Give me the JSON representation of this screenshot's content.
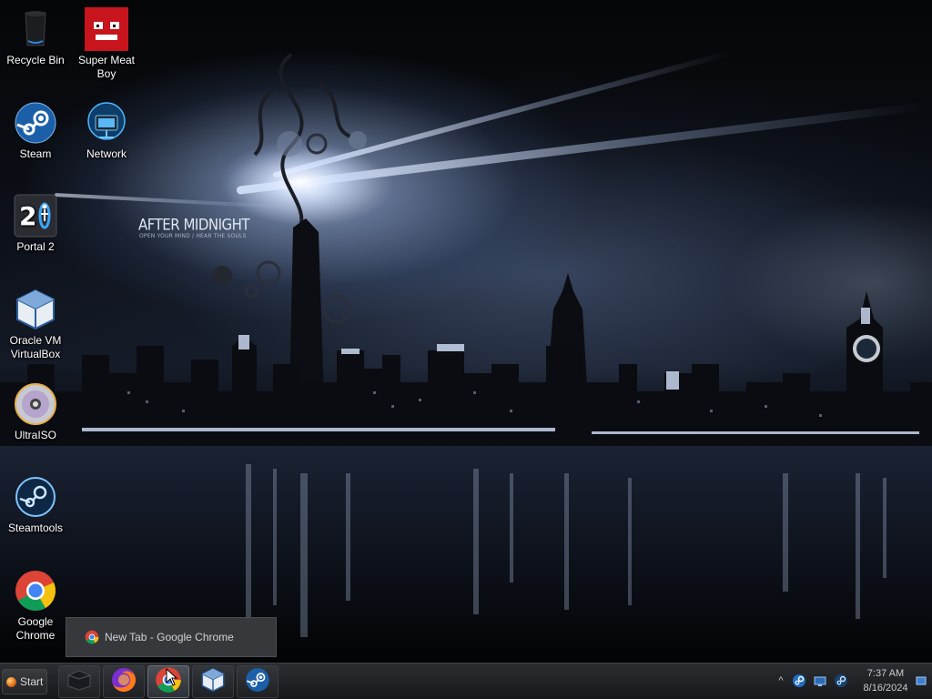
{
  "wallpaper": {
    "title": "AFTER MIDNIGHT",
    "subtitle": "OPEN YOUR MIND / HEAR THE SOULS"
  },
  "desktop_icons": [
    {
      "label": "Recycle Bin",
      "icon": "recycle-bin-icon"
    },
    {
      "label": "Super Meat Boy",
      "icon": "super-meat-boy-icon"
    },
    {
      "label": "Steam",
      "icon": "steam-icon"
    },
    {
      "label": "Network",
      "icon": "network-icon"
    },
    {
      "label": "Portal 2",
      "icon": "portal-2-icon"
    },
    {
      "label": "Oracle VM VirtualBox",
      "icon": "virtualbox-icon"
    },
    {
      "label": "UltraISO",
      "icon": "ultraiso-icon"
    },
    {
      "label": "Steamtools",
      "icon": "steamtools-icon"
    },
    {
      "label": "Google Chrome",
      "icon": "chrome-icon"
    }
  ],
  "taskbar": {
    "start_label": "Start",
    "pinned": [
      {
        "name": "explorer",
        "icon": "explorer-icon"
      },
      {
        "name": "firefox",
        "icon": "firefox-icon"
      },
      {
        "name": "chrome",
        "icon": "chrome-icon",
        "active": true
      },
      {
        "name": "virtualbox",
        "icon": "virtualbox-icon"
      },
      {
        "name": "steam",
        "icon": "steam-icon"
      }
    ]
  },
  "preview": {
    "title": "New Tab - Google Chrome"
  },
  "tray": {
    "chevron": "^",
    "time": "7:37 AM",
    "date": "8/16/2024"
  },
  "colors": {
    "steam_blue": "#1b5fa8",
    "chrome_red": "#db4437",
    "chrome_yellow": "#f4c20d",
    "chrome_green": "#0f9d58",
    "chrome_blue": "#4285f4",
    "smb_red": "#c8141c",
    "virtualbox_blue": "#2d5f9e"
  }
}
